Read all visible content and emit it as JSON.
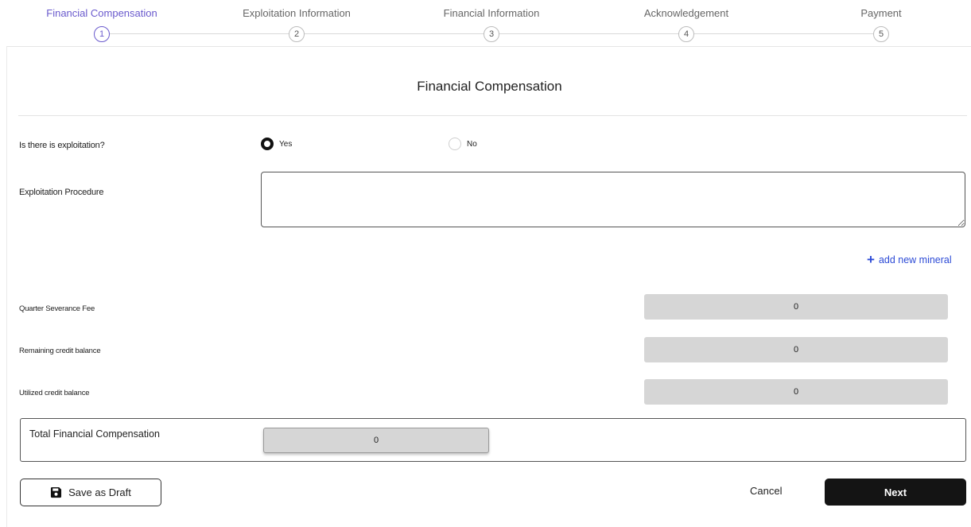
{
  "stepper": {
    "steps": [
      {
        "label": "Financial Compensation",
        "number": "1",
        "active": true
      },
      {
        "label": "Exploitation Information",
        "number": "2",
        "active": false
      },
      {
        "label": "Financial Information",
        "number": "3",
        "active": false
      },
      {
        "label": "Acknowledgement",
        "number": "4",
        "active": false
      },
      {
        "label": "Payment",
        "number": "5",
        "active": false
      }
    ]
  },
  "form": {
    "title": "Financial Compensation",
    "exploitation_question": "Is there is exploitation?",
    "options": {
      "yes": "Yes",
      "no": "No",
      "selected": "Yes"
    },
    "procedure_label": "Exploitation Procedure",
    "procedure_value": "",
    "add_mineral_label": "add new mineral",
    "fields": [
      {
        "label": "Quarter Severance Fee",
        "value": "0"
      },
      {
        "label": "Remaining credit balance",
        "value": "0"
      },
      {
        "label": "Utilized credit balance",
        "value": "0"
      }
    ],
    "total": {
      "label": "Total Financial Compensation",
      "value": "0"
    }
  },
  "actions": {
    "save_draft": "Save as Draft",
    "cancel": "Cancel",
    "next": "Next"
  },
  "colors": {
    "accent": "#6a5acd",
    "link": "#2d4bd6",
    "primary_button": "#141414",
    "readonly_field": "#d6d6d6"
  }
}
